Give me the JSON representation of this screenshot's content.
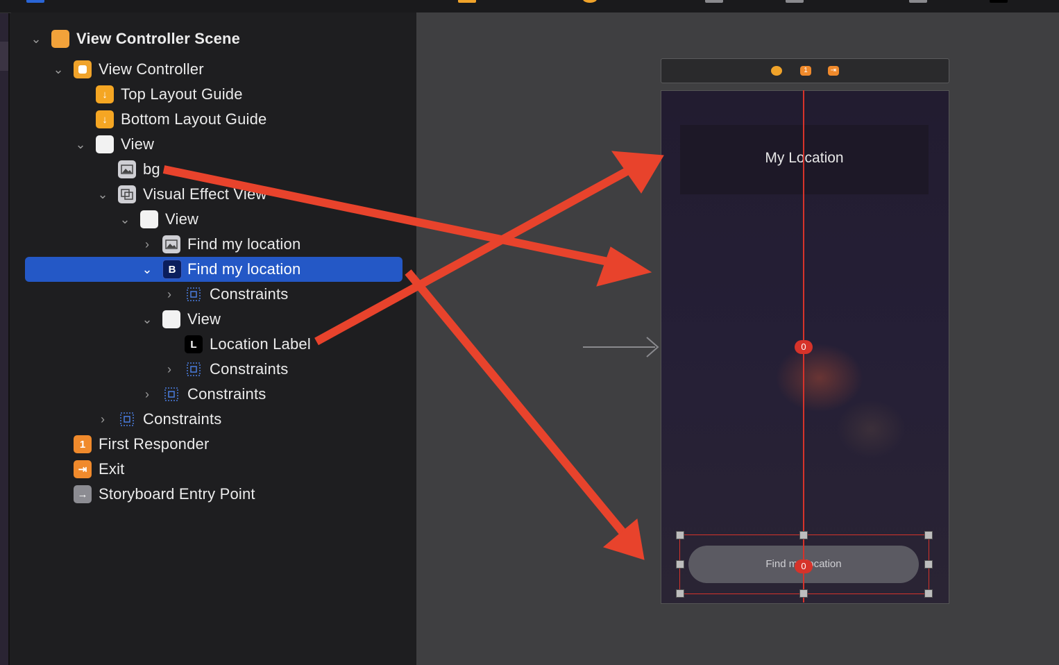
{
  "outline": {
    "rows": [
      {
        "label": "View Controller Scene",
        "icon": "scene-icon",
        "glyph": ""
      },
      {
        "label": "View Controller",
        "icon": "view-controller-icon",
        "glyph": ""
      },
      {
        "label": "Top Layout Guide",
        "icon": "layout-guide-icon",
        "glyph": "↓"
      },
      {
        "label": "Bottom Layout Guide",
        "icon": "layout-guide-icon",
        "glyph": "↓"
      },
      {
        "label": "View",
        "icon": "view-icon",
        "glyph": ""
      },
      {
        "label": "bg",
        "icon": "image-view-icon",
        "glyph": ""
      },
      {
        "label": "Visual Effect View",
        "icon": "visual-effect-icon",
        "glyph": ""
      },
      {
        "label": "View",
        "icon": "view-icon",
        "glyph": ""
      },
      {
        "label": "Find my location",
        "icon": "image-view-icon",
        "glyph": ""
      },
      {
        "label": "Find my location",
        "icon": "button-icon",
        "glyph": "B"
      },
      {
        "label": "Constraints",
        "icon": "constraints-icon",
        "glyph": ""
      },
      {
        "label": "View",
        "icon": "view-icon",
        "glyph": ""
      },
      {
        "label": "Location Label",
        "icon": "label-icon",
        "glyph": "L"
      },
      {
        "label": "Constraints",
        "icon": "constraints-icon",
        "glyph": ""
      },
      {
        "label": "Constraints",
        "icon": "constraints-icon",
        "glyph": ""
      },
      {
        "label": "Constraints",
        "icon": "constraints-icon",
        "glyph": ""
      },
      {
        "label": "First Responder",
        "icon": "first-responder-icon",
        "glyph": "1"
      },
      {
        "label": "Exit",
        "icon": "exit-icon",
        "glyph": "⇥"
      },
      {
        "label": "Storyboard Entry Point",
        "icon": "entry-point-icon",
        "glyph": "→"
      }
    ],
    "selected_index": 9
  },
  "canvas": {
    "location_label": "My Location",
    "button_label": "Find my location",
    "constraint_badge_top": "0",
    "constraint_badge_bottom": "0",
    "scene_bar_icons": [
      "view-controller-icon",
      "first-responder-icon",
      "exit-icon"
    ],
    "scene_bar_glyphs": [
      "",
      "1",
      "⇥"
    ]
  },
  "colors": {
    "selection": "#2458c6",
    "constraint_red": "#d6332a",
    "annotation_arrow": "#e8432c",
    "icon_orange": "#f0a32a"
  }
}
